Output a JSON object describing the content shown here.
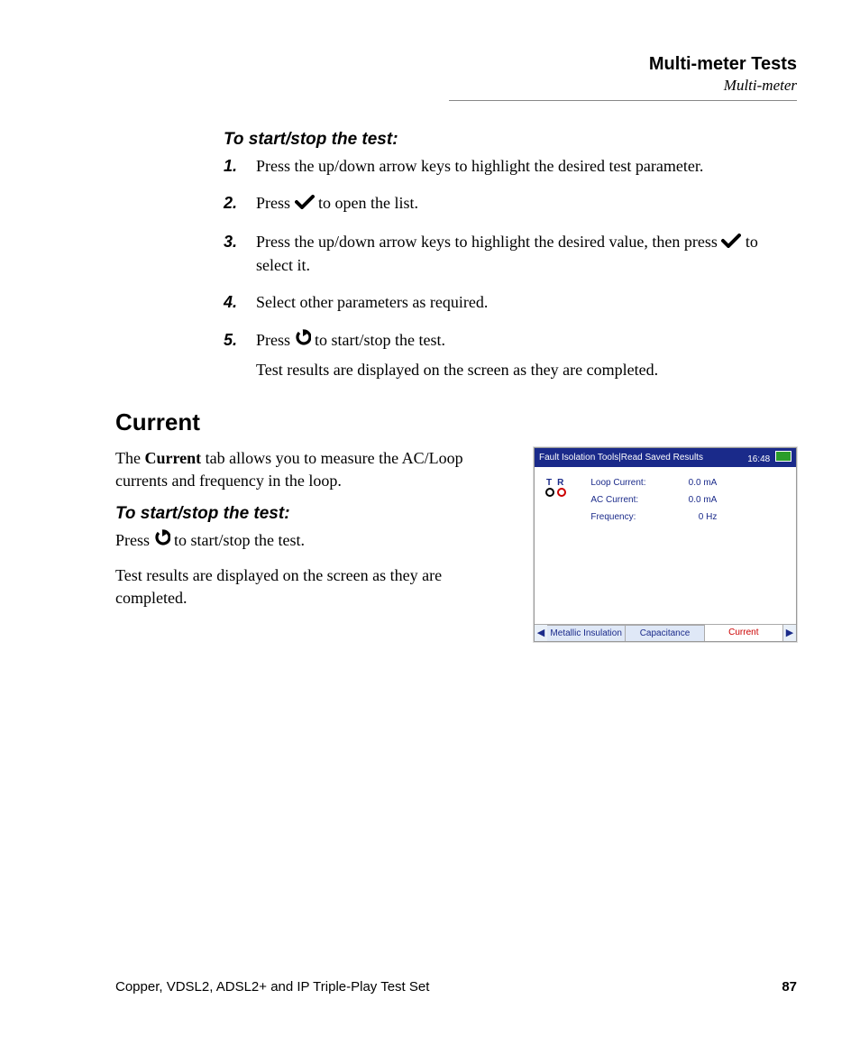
{
  "header": {
    "chapter": "Multi-meter Tests",
    "section": "Multi-meter"
  },
  "sec1": {
    "subhead": "To start/stop the test:",
    "step1": "Press the up/down arrow keys to highlight the desired test parameter.",
    "step2_pre": "Press ",
    "step2_post": " to open the list.",
    "step3_pre": "Press the up/down arrow keys to highlight the desired value, then press ",
    "step3_post": " to select it.",
    "step4": "Select other parameters as required.",
    "step5_pre": "Press ",
    "step5_post": " to start/stop the test.",
    "result": "Test results are displayed on the screen as they are completed."
  },
  "sec2": {
    "heading": "Current",
    "intro_pre": "The ",
    "intro_bold": "Current",
    "intro_post": " tab allows you to measure the AC/Loop currents and frequency in the loop.",
    "subhead": "To start/stop the test:",
    "press_pre": "Press ",
    "press_post": " to start/stop the test.",
    "result": "Test results are displayed on the screen as they are completed."
  },
  "screenshot": {
    "title": "Fault Isolation Tools|Read Saved Results",
    "time": "16:48",
    "tr": {
      "t": "T",
      "r": "R"
    },
    "rows": [
      {
        "label": "Loop Current:",
        "value": "0.0 mA"
      },
      {
        "label": "AC Current:",
        "value": "0.0 mA"
      },
      {
        "label": "Frequency:",
        "value": "0 Hz"
      }
    ],
    "tabs": {
      "left": "Metallic Insulation",
      "mid": "Capacitance",
      "right": "Current",
      "arrow_l": "◀",
      "arrow_r": "▶"
    }
  },
  "footer": {
    "left": "Copper, VDSL2, ADSL2+ and IP Triple-Play Test Set",
    "right": "87"
  }
}
